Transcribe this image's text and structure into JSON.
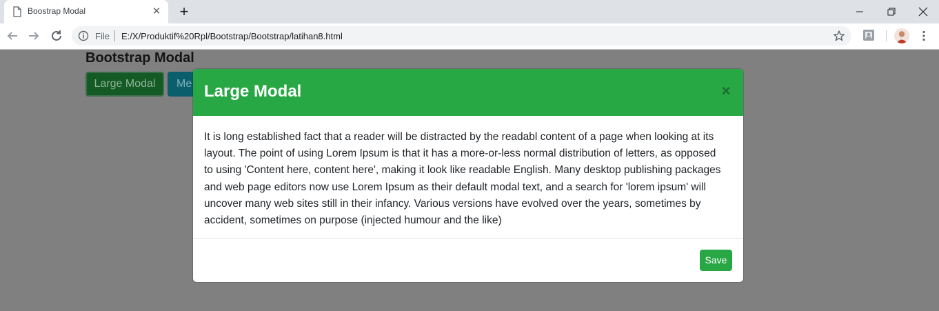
{
  "browser": {
    "tab_title": "Boostrap Modal",
    "tab_close": "✕",
    "new_tab": "+",
    "file_label": "File",
    "url": "E:/X/Produktif%20Rpl/Bootstrap/Bootstrap/latihan8.html"
  },
  "page": {
    "heading": "Bootstrap Modal",
    "large_button_label": "Large Modal",
    "medium_button_label": "Me"
  },
  "modal": {
    "title": "Large Modal",
    "close_label": "×",
    "body_text": "It is long established fact that a reader will be distracted by the readabl content of a page when looking at its layout. The point of using Lorem Ipsum is that it has a more-or-less normal distribution of letters, as opposed to using 'Content here, content here', making it look like readable English. Many desktop publishing packages and web page editors now use Lorem Ipsum as their default modal text, and a search for 'lorem ipsum' will uncover many web sites still in their infancy. Various versions have evolved over the years, sometimes by accident, sometimes on purpose (injected humour and the like)",
    "save_label": "Save"
  },
  "colors": {
    "modal_header": "#28a745",
    "overlay": "#808080",
    "large_button": "#145a25",
    "medium_button": "#0b5e6c"
  },
  "icons": [
    "page-icon",
    "close-icon",
    "plus-icon",
    "minimize-icon",
    "restore-icon",
    "back-arrow-icon",
    "forward-arrow-icon",
    "reload-icon",
    "info-icon",
    "star-icon",
    "extension-icon",
    "avatar",
    "kebab-menu-icon"
  ]
}
